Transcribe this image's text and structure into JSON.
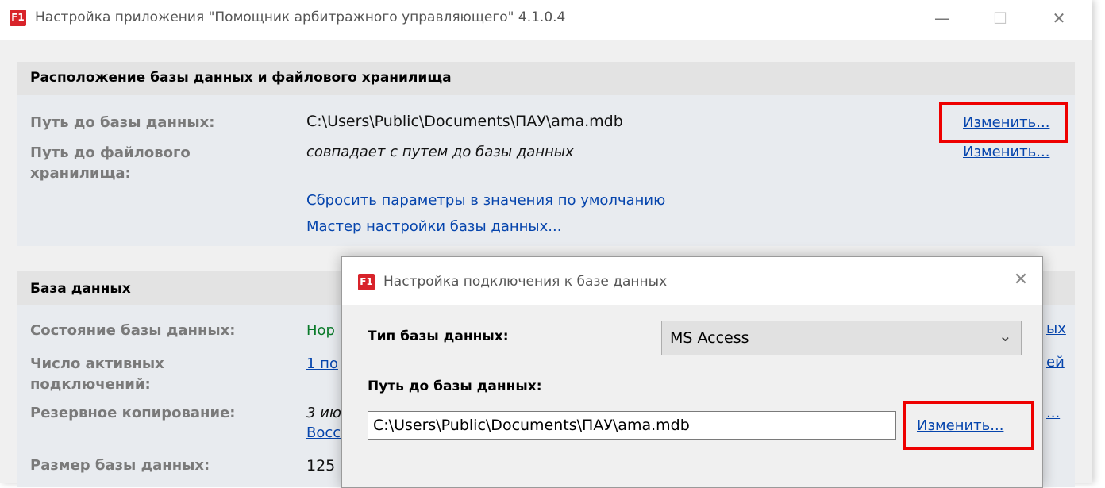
{
  "main_window": {
    "title": "Настройка приложения \"Помощник арбитражного управляющего\" 4.1.0.4",
    "app_icon": "F1",
    "controls": {
      "minimize": "—",
      "maximize": "☐",
      "close": "✕"
    }
  },
  "location_section": {
    "header": "Расположение базы данных и файлового хранилища",
    "db_path_label": "Путь до базы данных:",
    "db_path_value": "C:\\Users\\Public\\Documents\\ПАУ\\ama.mdb",
    "db_path_change": "Изменить...",
    "storage_label_line1": "Путь до файлового",
    "storage_label_line2": "хранилища:",
    "storage_value": "совпадает с путем до базы данных",
    "storage_change": "Изменить...",
    "reset_link": "Сбросить параметры в значения по умолчанию",
    "wizard_link": "Мастер настройки базы данных..."
  },
  "database_section": {
    "header": "База данных",
    "state_label": "Состояние базы данных:",
    "state_value_partial": "Нор",
    "active_label_line1": "Число активных",
    "active_label_line2": "подключений:",
    "active_value_partial": "1 по",
    "backup_label": "Резервное копирование:",
    "backup_value_partial": "3 ию",
    "backup_link_partial": "Восс",
    "size_label": "Размер базы данных:",
    "size_value_partial": "125",
    "right_link_1_partial": "ых",
    "right_link_2_partial": "ей",
    "right_link_3_partial": "..."
  },
  "dialog": {
    "title": "Настройка подключения к базе данных",
    "app_icon": "F1",
    "close": "✕",
    "db_type_label": "Тип базы данных:",
    "db_type_value": "MS Access",
    "db_path_label": "Путь до базы данных:",
    "db_path_value": "C:\\Users\\Public\\Documents\\ПАУ\\ama.mdb",
    "change_link": "Изменить...",
    "chevron": "⌄"
  },
  "colors": {
    "highlight_box": "#ee0000",
    "link": "#0645ad",
    "accent_icon": "#d8232a"
  }
}
